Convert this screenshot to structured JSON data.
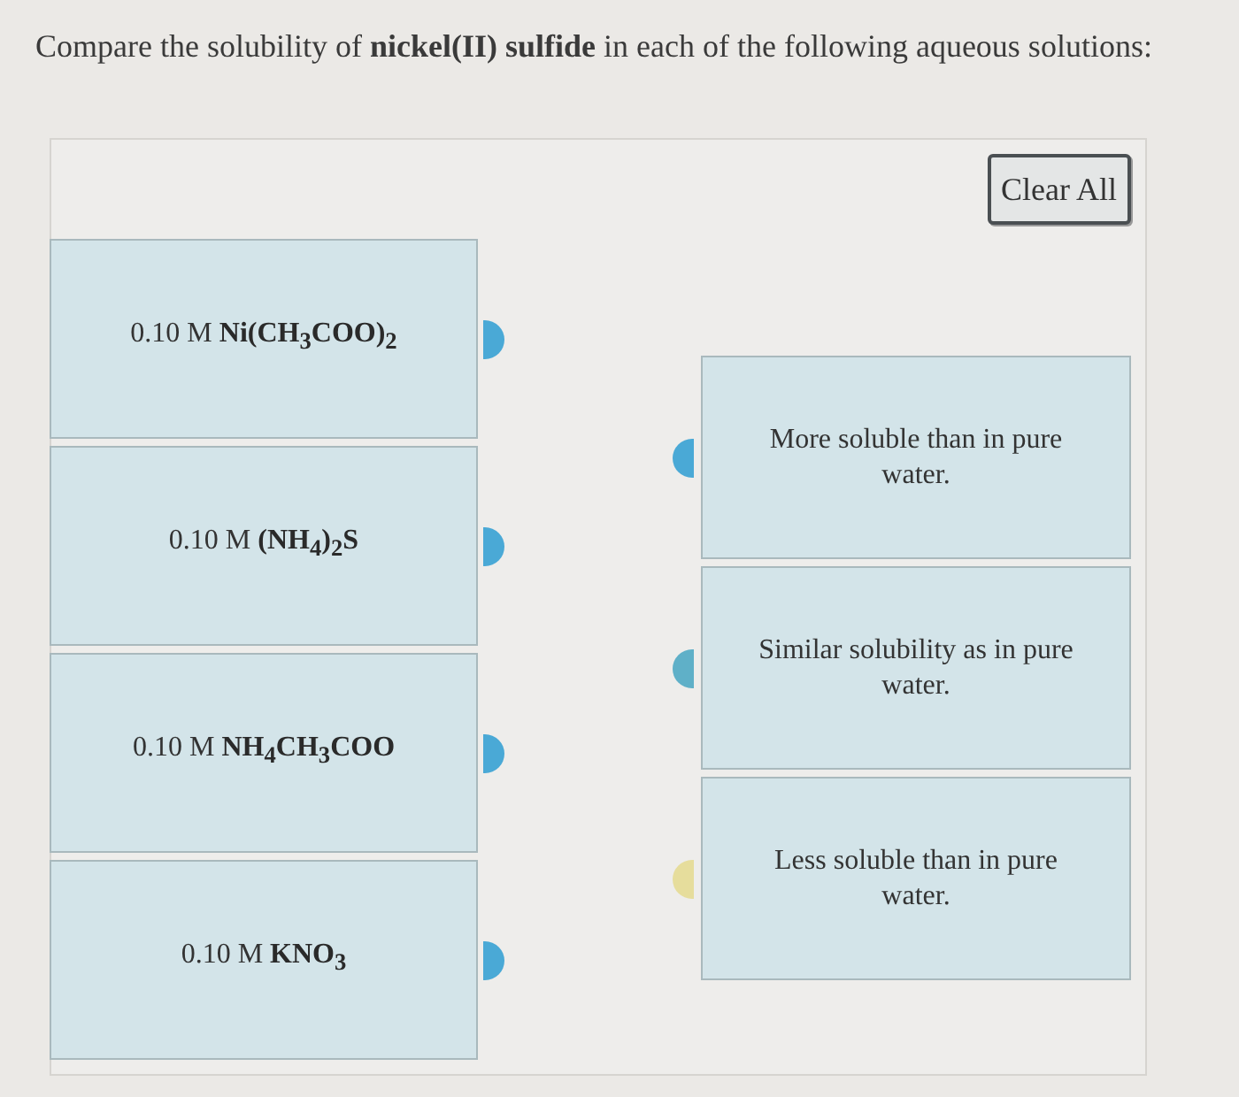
{
  "prompt": "Compare the solubility of **nickel(II) sulfide** in each of the following aqueous solutions:",
  "clear_button": {
    "label": "Clear All"
  },
  "solutions": [
    {
      "label": "0.10 M **Ni(CH$_{3}$COO)$_{2}$**",
      "color": "#4aa9d6"
    },
    {
      "label": "0.10 M **(NH$_{4}$)$_{2}$S**",
      "color": "#4aa9d6"
    },
    {
      "label": "0.10 M **NH$_{4}$CH$_{3}$COO**",
      "color": "#4aa9d6"
    },
    {
      "label": "0.10 M **KNO$_{3}$**",
      "color": "#4aa9d6"
    }
  ],
  "answers": [
    {
      "label": "More soluble than in pure water.",
      "color": "#4aa9d6"
    },
    {
      "label": "Similar solubility as in pure water.",
      "color": "#5fb0c8"
    },
    {
      "label": "Less soluble than in pure water.",
      "color": "#e6dd9c"
    }
  ]
}
